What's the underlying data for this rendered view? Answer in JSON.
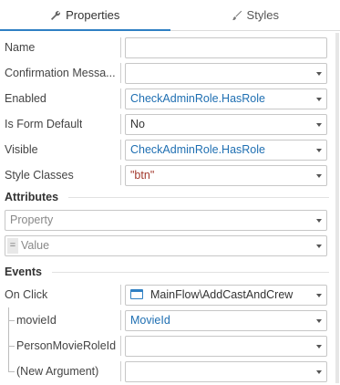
{
  "tabs": [
    {
      "label": "Properties",
      "icon": "wrench-icon",
      "active": true
    },
    {
      "label": "Styles",
      "icon": "brush-icon",
      "active": false
    }
  ],
  "properties": [
    {
      "label": "Name",
      "value": ""
    },
    {
      "label": "Confirmation Messa...",
      "value": ""
    },
    {
      "label": "Enabled",
      "value": "CheckAdminRole.HasRole"
    },
    {
      "label": "Is Form Default",
      "value": "No"
    },
    {
      "label": "Visible",
      "value": "CheckAdminRole.HasRole"
    },
    {
      "label": "Style Classes",
      "value": "\"btn\""
    }
  ],
  "attributes": {
    "title": "Attributes",
    "property_placeholder": "Property",
    "value_placeholder": "Value",
    "eq_symbol": "="
  },
  "events": {
    "title": "Events",
    "on_click_label": "On Click",
    "on_click_value": "MainFlow\\AddCastAndCrew",
    "arguments": [
      {
        "label": "movieId",
        "value": "MovieId"
      },
      {
        "label": "PersonMovieRoleId",
        "value": ""
      },
      {
        "label": "(New Argument)",
        "value": ""
      }
    ]
  },
  "colors": {
    "accent": "#2f80c4",
    "expression": "#1f6fb2",
    "string_literal": "#a33a2e"
  }
}
